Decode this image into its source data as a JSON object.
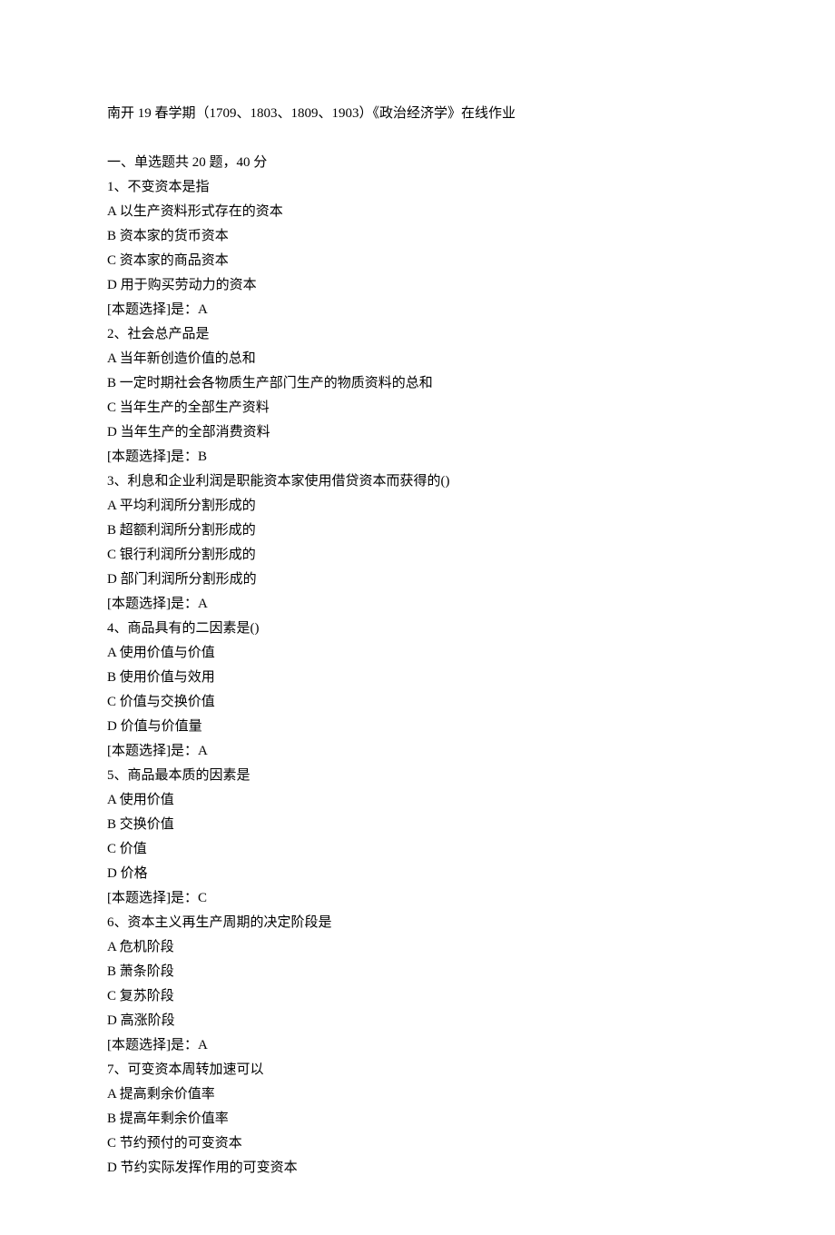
{
  "title": "南开 19 春学期（1709、1803、1809、1903）《政治经济学》在线作业",
  "section_header": "一、单选题共 20 题，40 分",
  "questions": [
    {
      "stem": "1、不变资本是指",
      "options": [
        "A 以生产资料形式存在的资本",
        "B 资本家的货币资本",
        "C 资本家的商品资本",
        "D 用于购买劳动力的资本"
      ],
      "answer": "[本题选择]是：A"
    },
    {
      "stem": "2、社会总产品是",
      "options": [
        "A 当年新创造价值的总和",
        "B 一定时期社会各物质生产部门生产的物质资料的总和",
        "C 当年生产的全部生产资料",
        "D 当年生产的全部消费资料"
      ],
      "answer": "[本题选择]是：B"
    },
    {
      "stem": "3、利息和企业利润是职能资本家使用借贷资本而获得的()",
      "options": [
        "A 平均利润所分割形成的",
        "B 超额利润所分割形成的",
        "C 银行利润所分割形成的",
        "D 部门利润所分割形成的"
      ],
      "answer": "[本题选择]是：A"
    },
    {
      "stem": "4、商品具有的二因素是()",
      "options": [
        "A 使用价值与价值",
        "B 使用价值与效用",
        "C 价值与交换价值",
        "D 价值与价值量"
      ],
      "answer": "[本题选择]是：A"
    },
    {
      "stem": "5、商品最本质的因素是",
      "options": [
        "A 使用价值",
        "B 交换价值",
        "C 价值",
        "D 价格"
      ],
      "answer": "[本题选择]是：C"
    },
    {
      "stem": "6、资本主义再生产周期的决定阶段是",
      "options": [
        "A 危机阶段",
        "B 萧条阶段",
        "C 复苏阶段",
        "D 高涨阶段"
      ],
      "answer": "[本题选择]是：A"
    },
    {
      "stem": "7、可变资本周转加速可以",
      "options": [
        "A 提高剩余价值率",
        "B 提高年剩余价值率",
        "C 节约预付的可变资本",
        "D 节约实际发挥作用的可变资本"
      ],
      "answer": ""
    }
  ]
}
